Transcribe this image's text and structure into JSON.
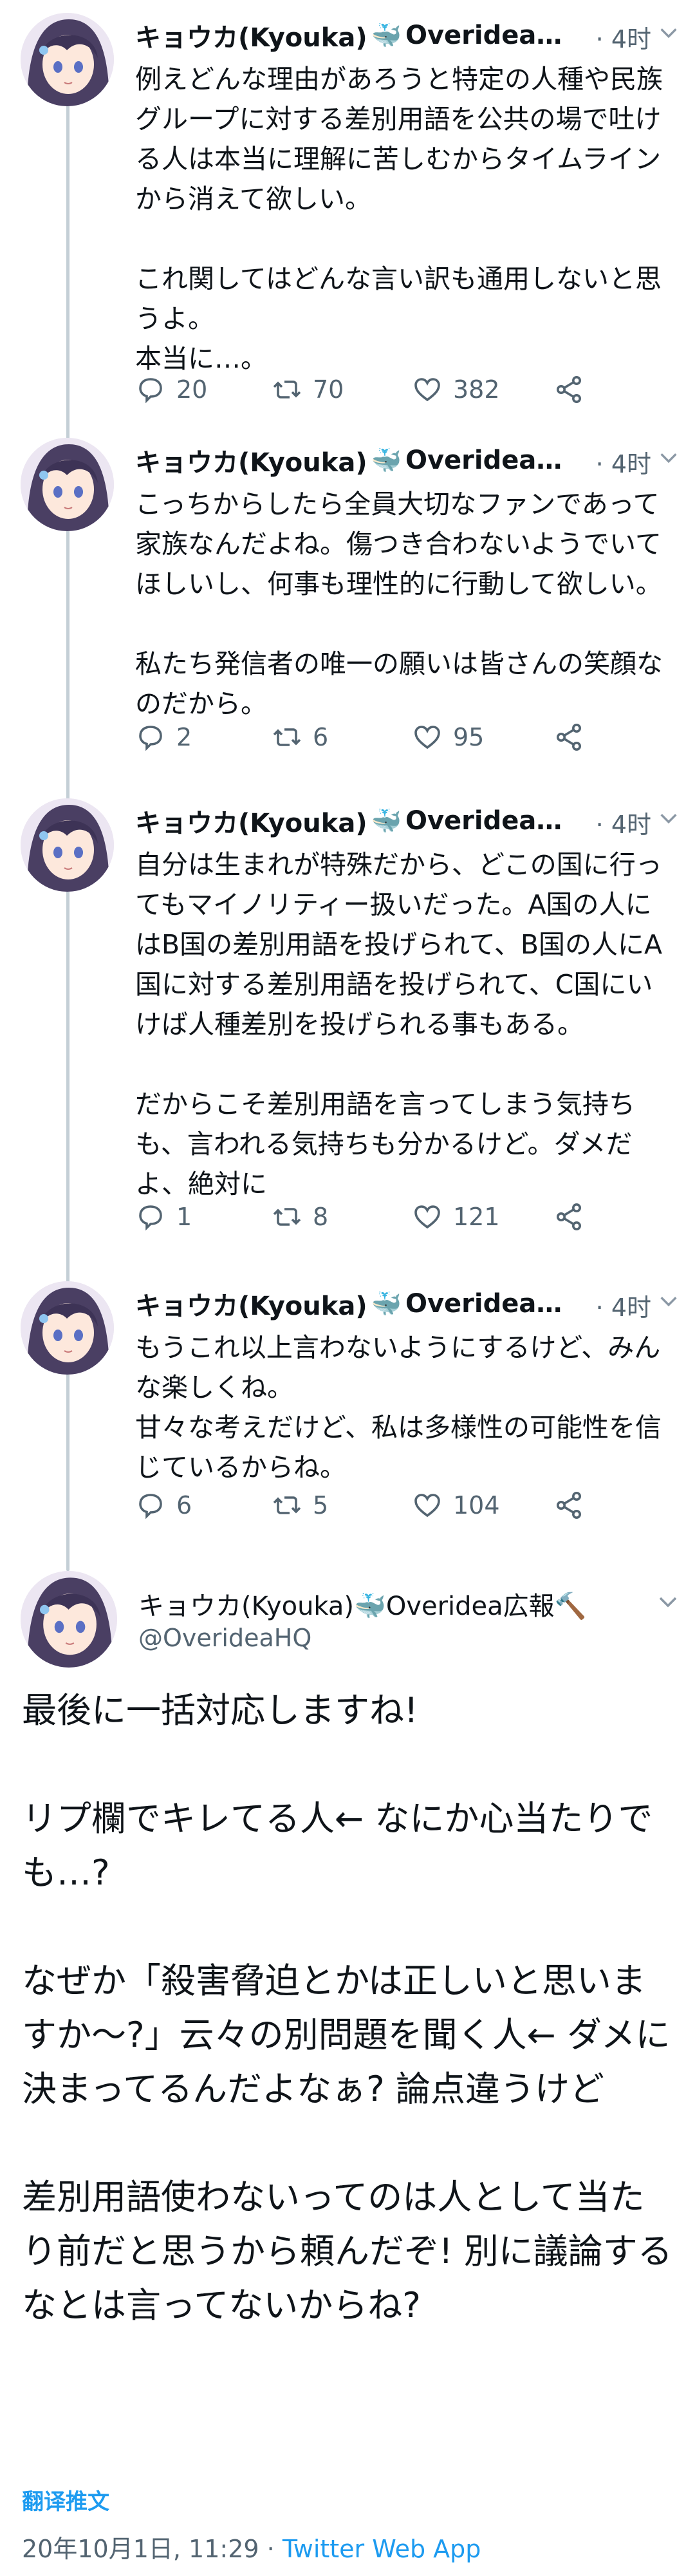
{
  "thread": [
    {
      "display_name": "キョウカ(Kyouka)",
      "emoji": "🐳",
      "name_suffix": "Overidea…",
      "time": "· 4时",
      "text": "例えどんな理由があろうと特定の人種や民族グループに対する差別用語を公共の場で吐ける人は本当に理解に苦しむからタイムラインから消えて欲しい。\n\nこれ関してはどんな言い訳も通用しないと思うよ。\n本当に…。",
      "replies": "20",
      "retweets": "70",
      "likes": "382"
    },
    {
      "display_name": "キョウカ(Kyouka)",
      "emoji": "🐳",
      "name_suffix": "Overidea…",
      "time": "· 4时",
      "text": "こっちからしたら全員大切なファンであって家族なんだよね。傷つき合わないようでいてほしいし、何事も理性的に行動して欲しい。\n\n私たち発信者の唯一の願いは皆さんの笑顔なのだから。",
      "replies": "2",
      "retweets": "6",
      "likes": "95"
    },
    {
      "display_name": "キョウカ(Kyouka)",
      "emoji": "🐳",
      "name_suffix": "Overidea…",
      "time": "· 4时",
      "text": "自分は生まれが特殊だから、どこの国に行ってもマイノリティー扱いだった。A国の人にはB国の差別用語を投げられて、B国の人にA国に対する差別用語を投げられて、C国にいけば人種差別を投げられる事もある。\n\nだからこそ差別用語を言ってしまう気持ちも、言われる気持ちも分かるけど。ダメだよ、絶対に",
      "replies": "1",
      "retweets": "8",
      "likes": "121"
    },
    {
      "display_name": "キョウカ(Kyouka)",
      "emoji": "🐳",
      "name_suffix": "Overidea…",
      "time": "· 4时",
      "text": "もうこれ以上言わないようにするけど、みんな楽しくね。\n甘々な考えだけど、私は多様性の可能性を信じているからね。",
      "replies": "6",
      "retweets": "5",
      "likes": "104"
    }
  ],
  "main_tweet": {
    "display_name": "キョウカ(Kyouka)",
    "emoji": "🐳",
    "name_suffix": "Overidea広報🔨",
    "handle": "@OverideaHQ",
    "text": "最後に一括対応しますね!\n\nリプ欄でキレてる人← なにか心当たりでも…?\n\nなぜか「殺害脅迫とかは正しいと思いますか～?」云々の別問題を聞く人← ダメに決まってるんだよなぁ? 論点違うけど\n\n差別用語使わないってのは人として当たり前だと思うから頼んだぞ! 別に議論するなとは言ってないからね?",
    "translate_label": "翻译推文",
    "timestamp": "20年10月1日, 11:29",
    "separator": " · ",
    "source": "Twitter Web App"
  },
  "colors": {
    "link": "#1d9bf0",
    "secondary_text": "#536471",
    "thread_line": "#c4cfd6"
  },
  "icons": [
    "avatar",
    "whale-emoji",
    "chevron-down-icon",
    "reply-icon",
    "retweet-icon",
    "like-icon",
    "share-icon",
    "hammer-emoji"
  ]
}
